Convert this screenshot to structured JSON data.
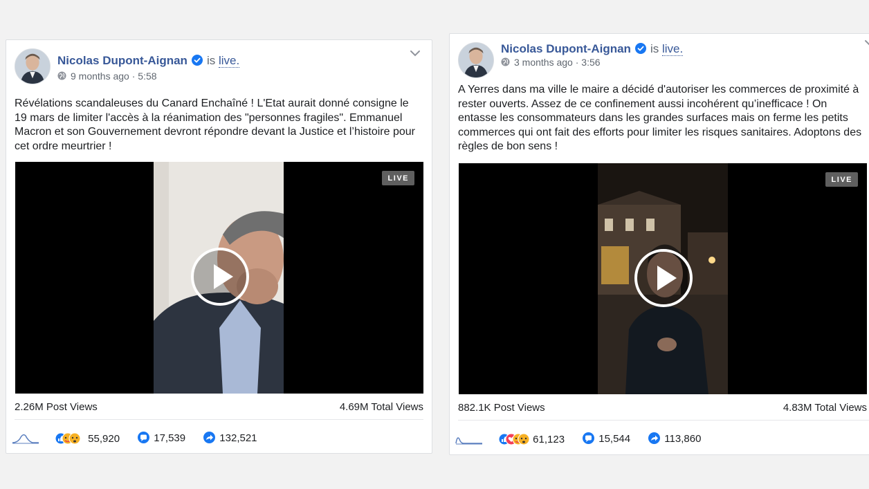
{
  "posts": [
    {
      "author": "Nicolas Dupont-Aignan",
      "is_text": "is",
      "live_text": "live.",
      "time_ago": "9 months ago",
      "separator": "·",
      "duration": "5:58",
      "text": "Révélations scandaleuses du Canard Enchaîné ! L'Etat aurait donné consigne le 19 mars de limiter l'accès à la réanimation des \"personnes fragiles\". Emmanuel Macron et son Gouvernement devront répondre devant la Justice et l’histoire pour cet ordre meurtrier !",
      "live_badge": "LIVE",
      "post_views": "2.26M Post Views",
      "total_views": "4.69M Total Views",
      "reactions": "55,920",
      "comments": "17,539",
      "shares": "132,521",
      "icons": {
        "verified": "verified-badge-icon",
        "globe": "globe-icon",
        "menu": "chevron-down-icon",
        "play": "play-icon"
      }
    },
    {
      "author": "Nicolas Dupont-Aignan",
      "is_text": "is",
      "live_text": "live.",
      "time_ago": "3 months ago",
      "separator": "·",
      "duration": "3:56",
      "text": "A Yerres dans ma ville le maire a décidé d'autoriser les commerces de proximité à rester ouverts. Assez de ce confinement aussi incohérent qu’inefficace ! On entasse les consommateurs dans les grandes surfaces mais on ferme les petits commerces qui ont fait des efforts pour limiter les risques sanitaires. Adoptons des règles de bon sens !",
      "live_badge": "LIVE",
      "post_views": "882.1K Post Views",
      "total_views": "4.83M Total Views",
      "reactions": "61,123",
      "comments": "15,544",
      "shares": "113,860",
      "icons": {
        "verified": "verified-badge-icon",
        "globe": "globe-icon",
        "menu": "chevron-down-icon",
        "play": "play-icon"
      }
    }
  ],
  "colors": {
    "link": "#385898",
    "verified": "#1877f2",
    "meta": "#606770",
    "background": "#f2f2f2"
  }
}
